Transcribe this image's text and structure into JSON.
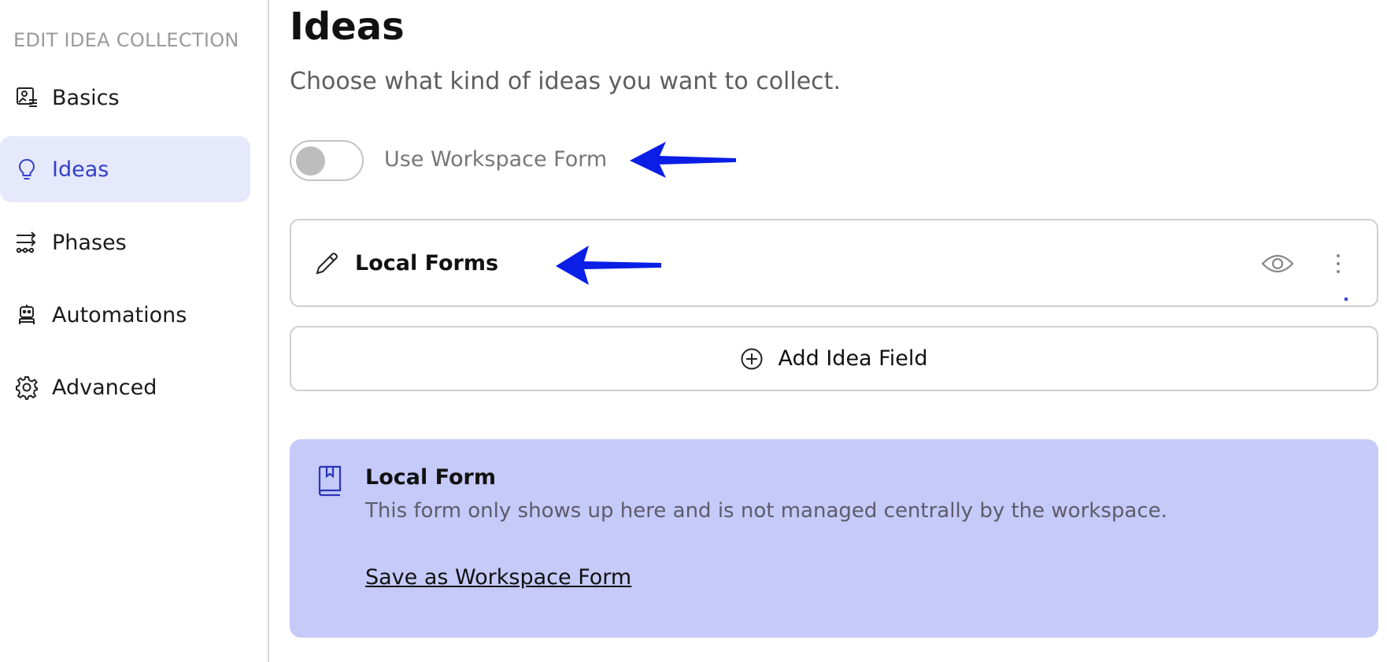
{
  "sidebar": {
    "title": "EDIT IDEA COLLECTION",
    "items": [
      {
        "label": "Basics",
        "icon": "image-settings-icon",
        "active": false
      },
      {
        "label": "Ideas",
        "icon": "lightbulb-icon",
        "active": true
      },
      {
        "label": "Phases",
        "icon": "phases-flow-icon",
        "active": false
      },
      {
        "label": "Automations",
        "icon": "robot-icon",
        "active": false
      },
      {
        "label": "Advanced",
        "icon": "gear-icon",
        "active": false
      }
    ]
  },
  "main": {
    "title": "Ideas",
    "subtitle": "Choose what kind of ideas you want to collect.",
    "toggle": {
      "label": "Use Workspace Form",
      "on": false
    },
    "form_card": {
      "title": "Local Forms"
    },
    "add_button": {
      "label": "Add Idea Field"
    },
    "info": {
      "title": "Local Form",
      "description": "This form only shows up here and is not managed centrally by the workspace.",
      "link": "Save as Workspace Form"
    }
  },
  "colors": {
    "accent": "#3340c9",
    "active_bg": "#e6e8fb",
    "info_bg": "#c5caf9",
    "annotation_arrow": "#0a1ee6"
  }
}
